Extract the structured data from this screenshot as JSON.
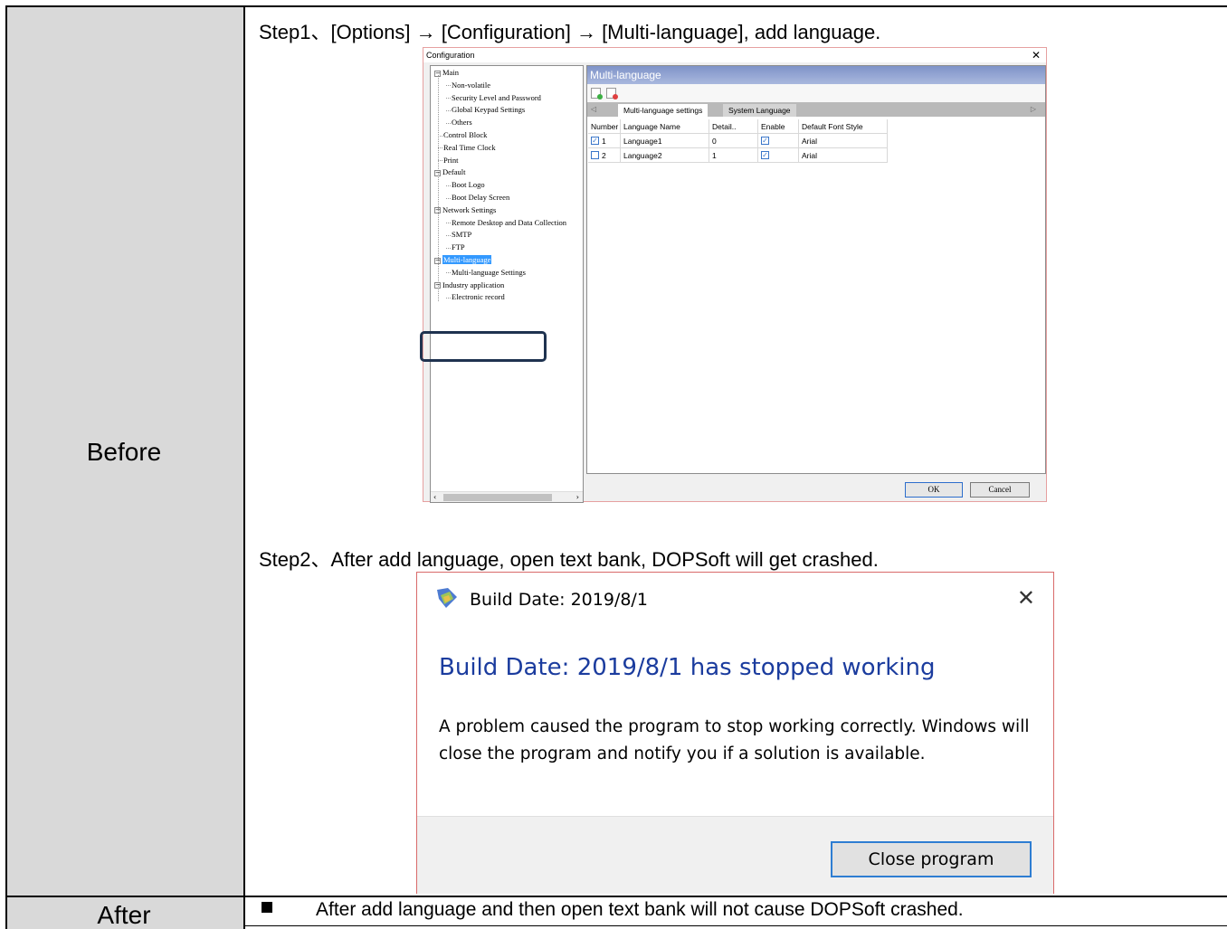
{
  "rows": {
    "before_label": "Before",
    "after_label": "After"
  },
  "step1_text": "Step1、[Options] → [Configuration] → [Multi-language], add language.",
  "step2_text": "Step2、After add language, open text bank, DOPSoft will get crashed.",
  "after_text": "After add language and then open text bank will not cause DOPSoft crashed.",
  "config_dialog": {
    "title": "Configuration",
    "close_glyph": "✕",
    "tree": [
      {
        "label": "Main",
        "level": 0,
        "expander": "−"
      },
      {
        "label": "Non-volatile",
        "level": 1
      },
      {
        "label": "Security Level and Password",
        "level": 1
      },
      {
        "label": "Global Keypad Settings",
        "level": 1
      },
      {
        "label": "Others",
        "level": 1
      },
      {
        "label": "Control Block",
        "level": 0
      },
      {
        "label": "Real Time Clock",
        "level": 0
      },
      {
        "label": "Print",
        "level": 0
      },
      {
        "label": "Default",
        "level": 0,
        "expander": "−"
      },
      {
        "label": "Boot Logo",
        "level": 1
      },
      {
        "label": "Boot Delay Screen",
        "level": 1
      },
      {
        "label": "Network Settings",
        "level": 0,
        "expander": "−"
      },
      {
        "label": "Remote Desktop and Data Collection",
        "level": 1
      },
      {
        "label": "SMTP",
        "level": 1
      },
      {
        "label": "FTP",
        "level": 1
      },
      {
        "label": "Multi-language",
        "level": 0,
        "expander": "−",
        "selected": true
      },
      {
        "label": "Multi-language Settings",
        "level": 1
      },
      {
        "label": "Industry application",
        "level": 0,
        "expander": "−"
      },
      {
        "label": "Electronic record",
        "level": 1
      }
    ],
    "panel_title": "Multi-language",
    "tabs": {
      "active": "Multi-language settings",
      "inactive": "System Language"
    },
    "grid_headers": [
      "Number",
      "Language Name",
      "Detail..",
      "Enable",
      "Default Font Style"
    ],
    "grid_rows": [
      {
        "checked": true,
        "number": "1",
        "name": "Language1",
        "detail": "0",
        "enable": true,
        "font": "Arial"
      },
      {
        "checked": false,
        "number": "2",
        "name": "Language2",
        "detail": "1",
        "enable": true,
        "font": "Arial"
      }
    ],
    "ok_label": "OK",
    "cancel_label": "Cancel"
  },
  "crash_dialog": {
    "title": "Build Date: 2019/8/1",
    "close_glyph": "✕",
    "heading": "Build Date: 2019/8/1 has stopped working",
    "body": "A problem caused the program to stop working correctly. Windows will close the program and notify you if a solution is available.",
    "button_label": "Close program"
  }
}
